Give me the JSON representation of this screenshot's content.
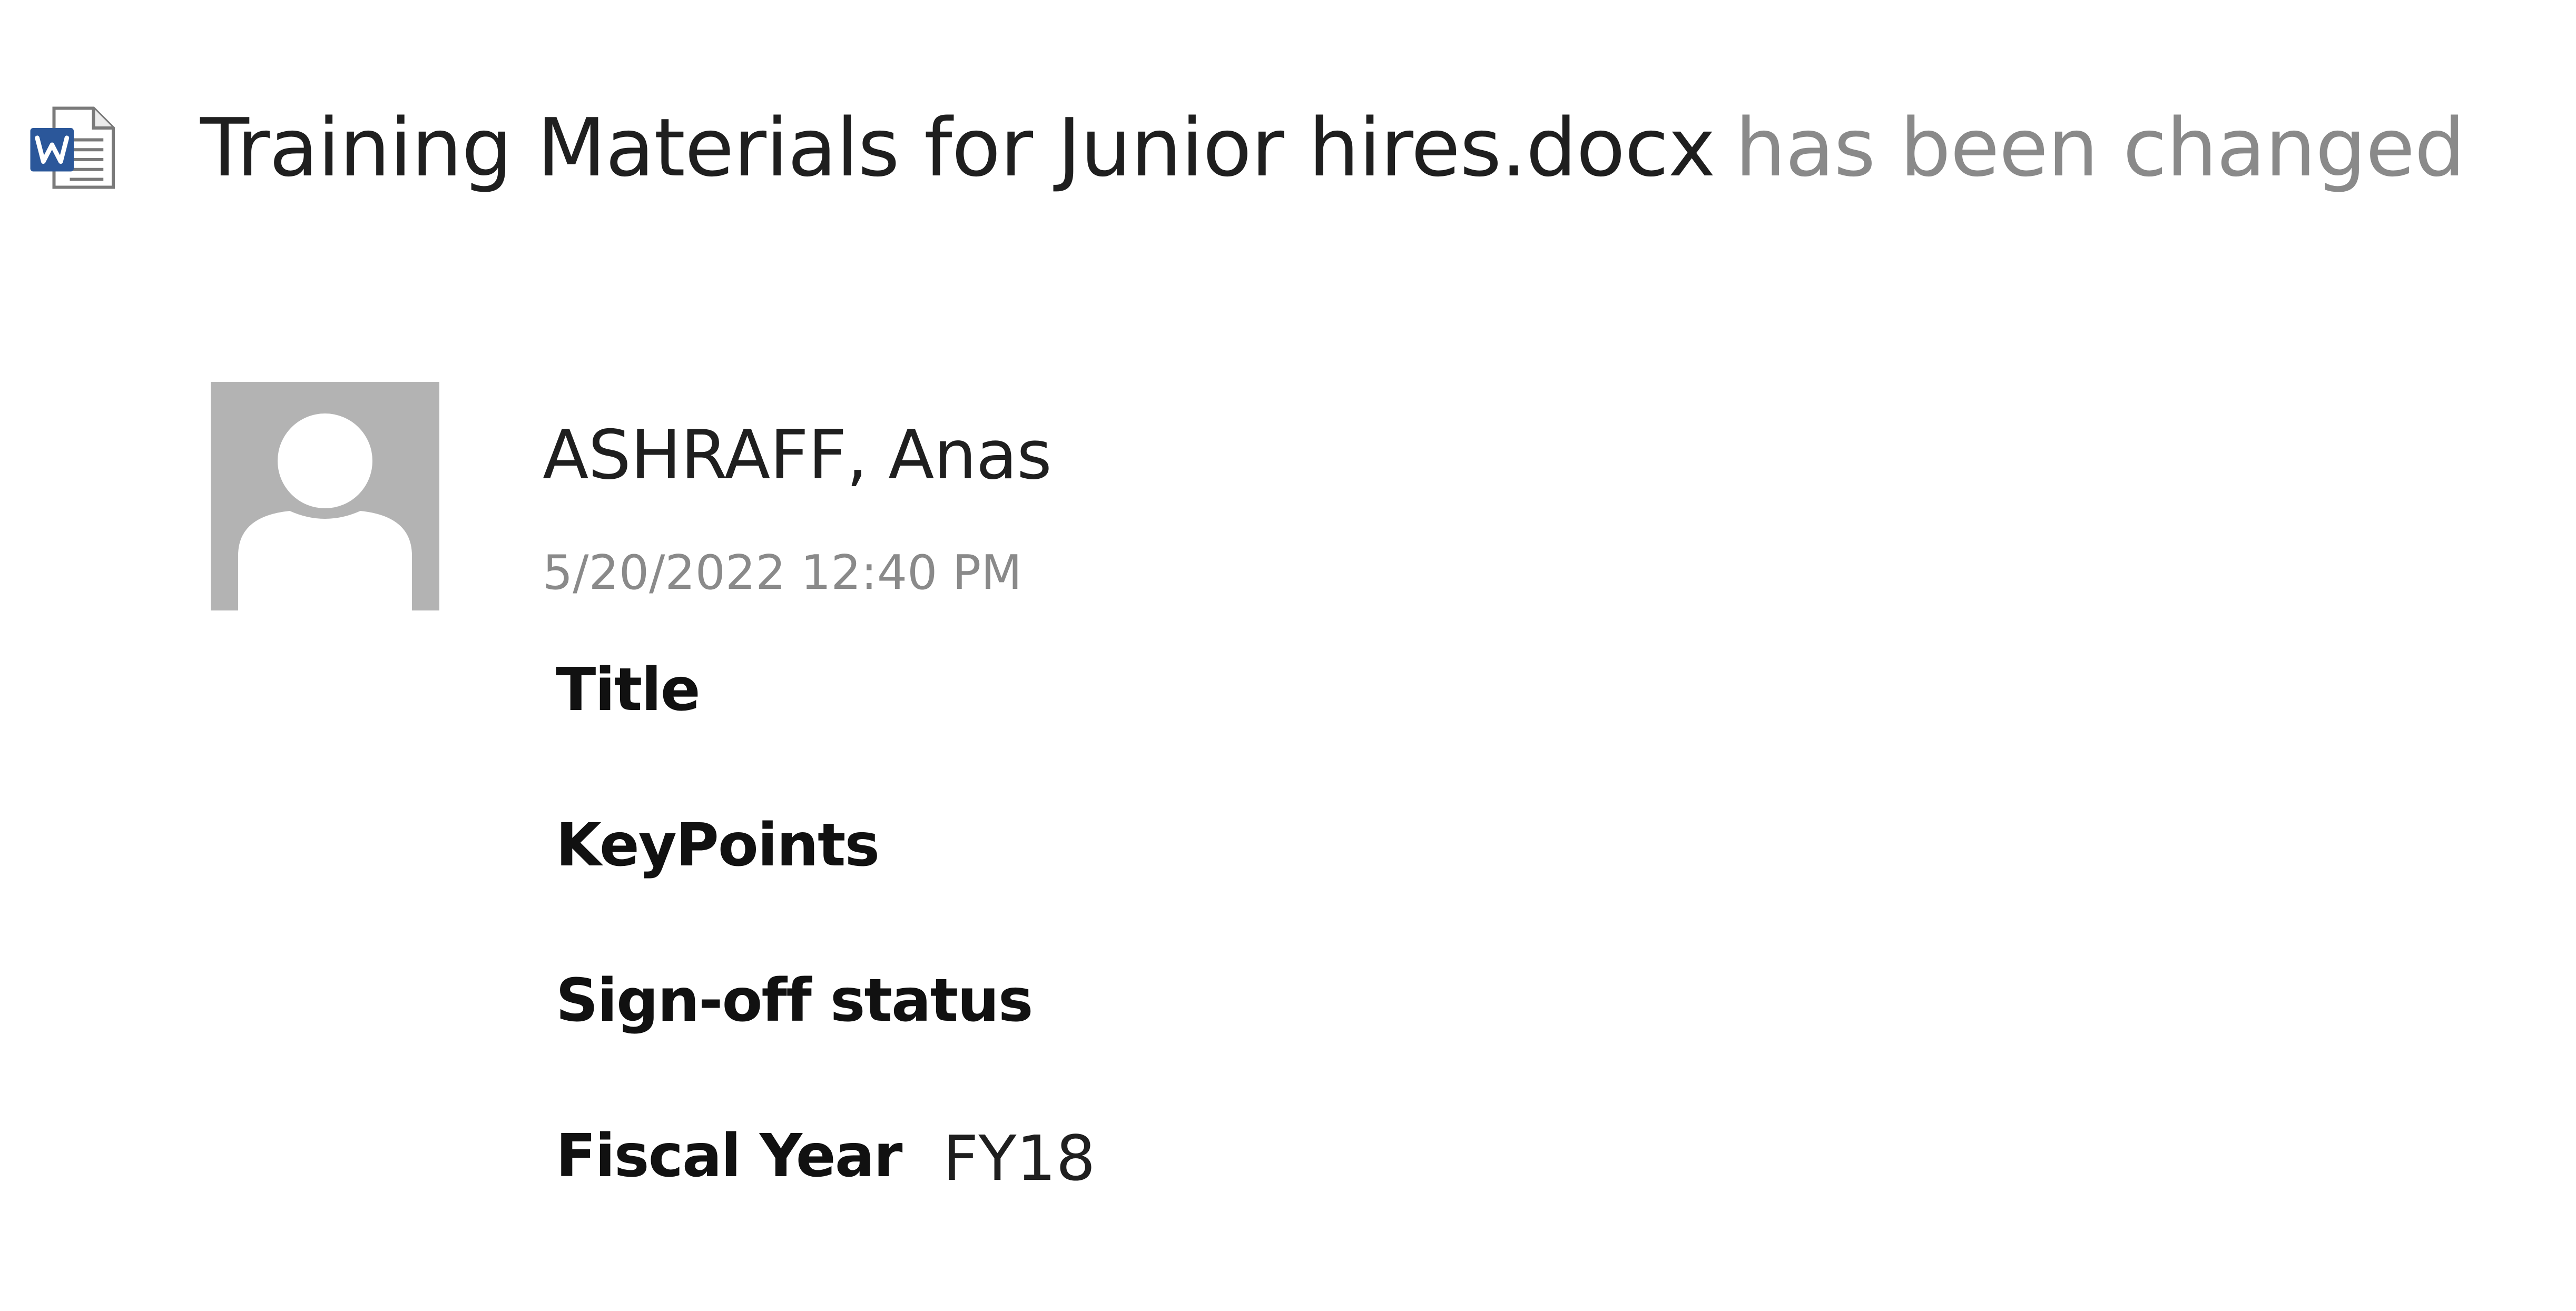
{
  "notification": {
    "file_icon": "word-document-icon",
    "file_name": "Training Materials for Junior hires.docx",
    "action_text": "has been changed"
  },
  "activity": {
    "avatar_icon": "default-person-avatar",
    "author": "ASHRAFF, Anas",
    "timestamp": "5/20/2022 12:40 PM",
    "fields": [
      {
        "label": "Title",
        "value": ""
      },
      {
        "label": "KeyPoints",
        "value": ""
      },
      {
        "label": "Sign-off status",
        "value": ""
      },
      {
        "label": "Fiscal Year",
        "value": "FY18"
      }
    ]
  },
  "colors": {
    "primary_text": "#1f1f1f",
    "secondary_text": "#8a8a8a",
    "avatar_background": "#b3b3b3",
    "word_brand_blue": "#2b579a"
  }
}
